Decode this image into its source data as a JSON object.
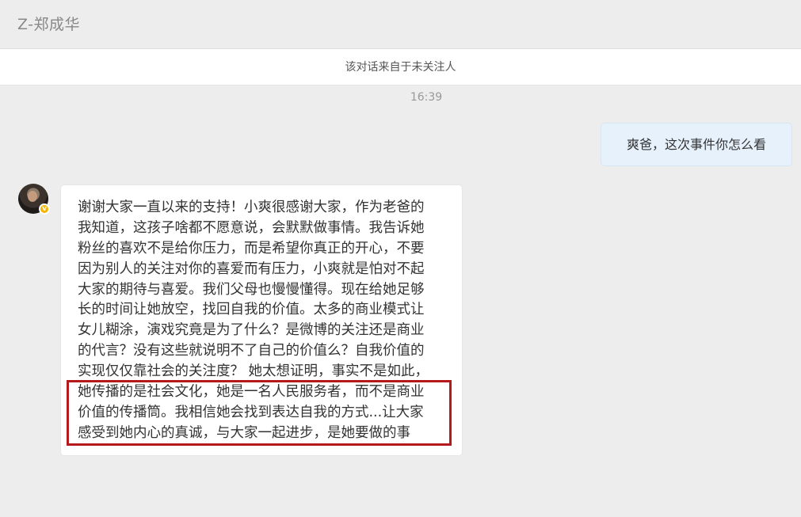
{
  "header": {
    "title": "Z-郑成华"
  },
  "notice": {
    "text": "该对话来自于未关注人"
  },
  "timestamp": "16:39",
  "outgoing_message": {
    "text": "爽爸，这次事件你怎么看"
  },
  "incoming_message": {
    "lines": [
      "谢谢大家一直以来的支持！小爽很感谢大家，作为老爸的",
      "我知道，这孩子啥都不愿意说，会默默做事情。我告诉她",
      "粉丝的喜欢不是给你压力，而是希望你真正的开心，不要",
      "因为别人的关注对你的喜爱而有压力，小爽就是怕对不起",
      "大家的期待与喜爱。我们父母也慢慢懂得。现在给她足够",
      "长的时间让她放空，找回自我的价值。太多的商业模式让",
      "女儿糊涂，演戏究竟是为了什么？是微博的关注还是商业",
      "的代言？没有这些就说明不了自己的价值么？自我价值的",
      "实现仅仅靠社会的关注度？ 她太想证明，事实不是如此，",
      "她传播的是社会文化，她是一名人民服务者，而不是商业",
      "价值的传播筒。我相信她会找到表达自我的方式...让大家",
      "感受到她内心的真诚，与大家一起进步，是她要做的事"
    ],
    "highlight_color": "#b4191b"
  },
  "avatar": {
    "badge_icon": "verified-v-badge",
    "badge_glyph": "v"
  }
}
